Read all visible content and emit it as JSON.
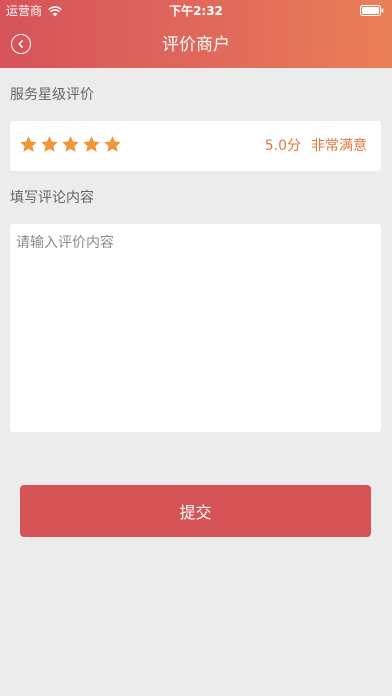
{
  "status_bar": {
    "carrier": "运营商",
    "time": "下午2:32",
    "wifi_icon": "wifi-icon",
    "battery_icon": "battery-icon"
  },
  "nav": {
    "back_icon": "chevron-left-icon",
    "title": "评价商户"
  },
  "rating_section": {
    "label": "服务星级评价",
    "stars_filled": 5,
    "stars_total": 5,
    "star_color": "#f0973b",
    "score_text": "5.0分",
    "satisfaction_text": "非常满意",
    "text_color": "#e07a3c"
  },
  "comment_section": {
    "label": "填写评论内容",
    "value": "",
    "placeholder": "请输入评价内容"
  },
  "submit": {
    "label": "提交",
    "color": "#d65355"
  },
  "colors": {
    "header_start": "#d6535a",
    "header_end": "#ea8058",
    "background": "#ececec"
  }
}
